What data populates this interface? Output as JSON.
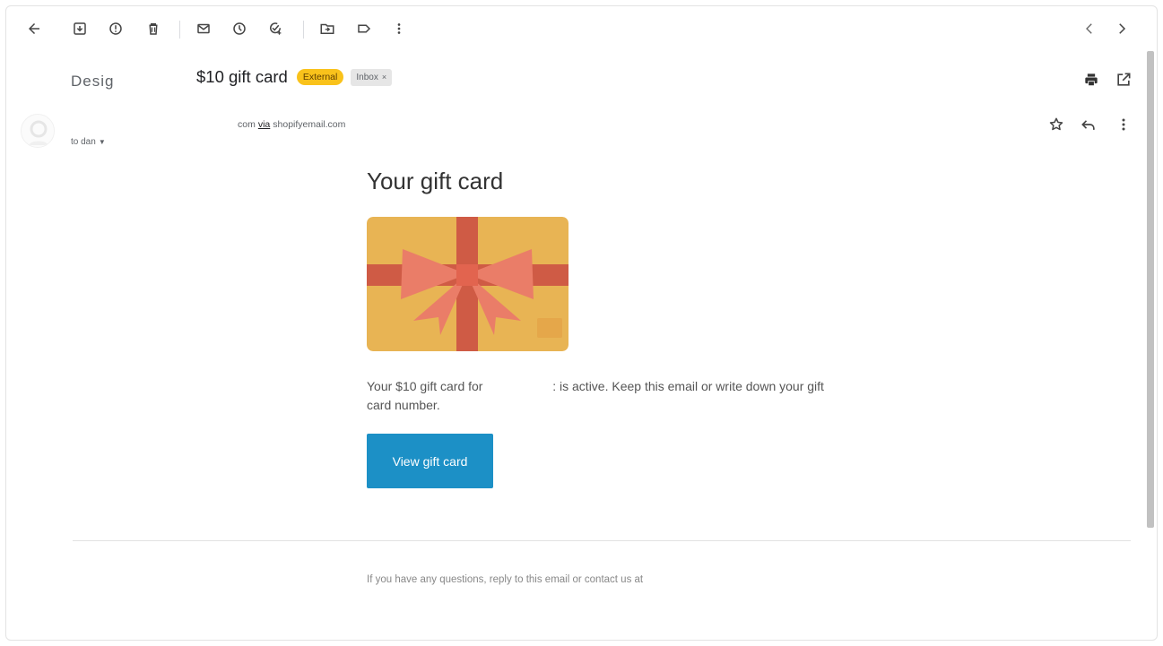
{
  "toolbar": {
    "icons": [
      "back-arrow-icon",
      "archive-icon",
      "report-spam-icon",
      "delete-icon",
      "mark-unread-icon",
      "snooze-icon",
      "add-to-tasks-icon",
      "move-to-icon",
      "label-icon",
      "more-vert-icon",
      "prev-chevron-icon",
      "next-chevron-icon"
    ]
  },
  "header": {
    "sender_short": "Desig",
    "subject": "$10 gift card",
    "chip_external": "External",
    "chip_inbox": "Inbox",
    "chip_inbox_close": "×"
  },
  "sender": {
    "domain_part": "com",
    "via_label": "via",
    "via_domain": "shopifyemail.com",
    "to_label": "to dan",
    "caret": "▼"
  },
  "message": {
    "title": "Your gift card",
    "text_before": "Your $10 gift card for",
    "text_after": ": is active. Keep this email or write down your gift card number.",
    "button_label": "View gift card",
    "footer": "If you have any questions, reply to this email or contact us at"
  },
  "colors": {
    "accent_button": "#1c90c6",
    "external_chip": "#f9c21b",
    "gift_card_bg": "#e8b454",
    "ribbon": "#cf5b45",
    "bow": "#ea7d68"
  }
}
